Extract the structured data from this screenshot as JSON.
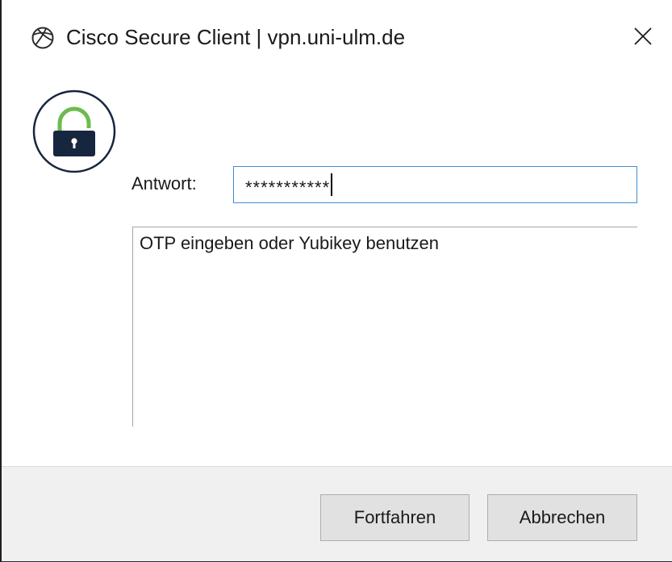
{
  "window": {
    "title": "Cisco Secure Client | vpn.uni-ulm.de",
    "icon": "globe-icon",
    "close_icon": "close-icon"
  },
  "badge": {
    "icon": "lock-icon",
    "colors": {
      "shackle": "#6dbb4e",
      "body": "#17263f",
      "ring": "#17263f"
    }
  },
  "form": {
    "answer_label": "Antwort:",
    "answer_value": "***********",
    "message": "OTP eingeben oder Yubikey benutzen"
  },
  "buttons": {
    "continue_label": "Fortfahren",
    "cancel_label": "Abbrechen"
  },
  "colors": {
    "input_border": "#3f8fd8",
    "footer_bg": "#f0f0f0",
    "button_bg": "#e1e1e1"
  }
}
